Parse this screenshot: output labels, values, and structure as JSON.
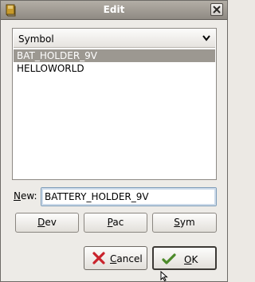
{
  "window": {
    "title": "Edit"
  },
  "list": {
    "header": "Symbol",
    "items": [
      "BAT_HOLDER_9V",
      "HELLOWORLD"
    ],
    "selected_index": 0
  },
  "new_field": {
    "label": "New:",
    "value": "BATTERY_HOLDER_9V"
  },
  "buttons": {
    "dev": "Dev",
    "pac": "Pac",
    "sym": "Sym",
    "cancel": "Cancel",
    "ok": "OK"
  },
  "icons": {
    "app": "book-icon",
    "close": "close-icon",
    "sort": "chevron-down-icon",
    "cancel": "red-x-icon",
    "ok": "green-check-icon"
  },
  "colors": {
    "selection": "#9c9891",
    "titlebar": "#a09b94",
    "cancel_icon": "#c9232c",
    "ok_icon": "#4c8a2a"
  }
}
